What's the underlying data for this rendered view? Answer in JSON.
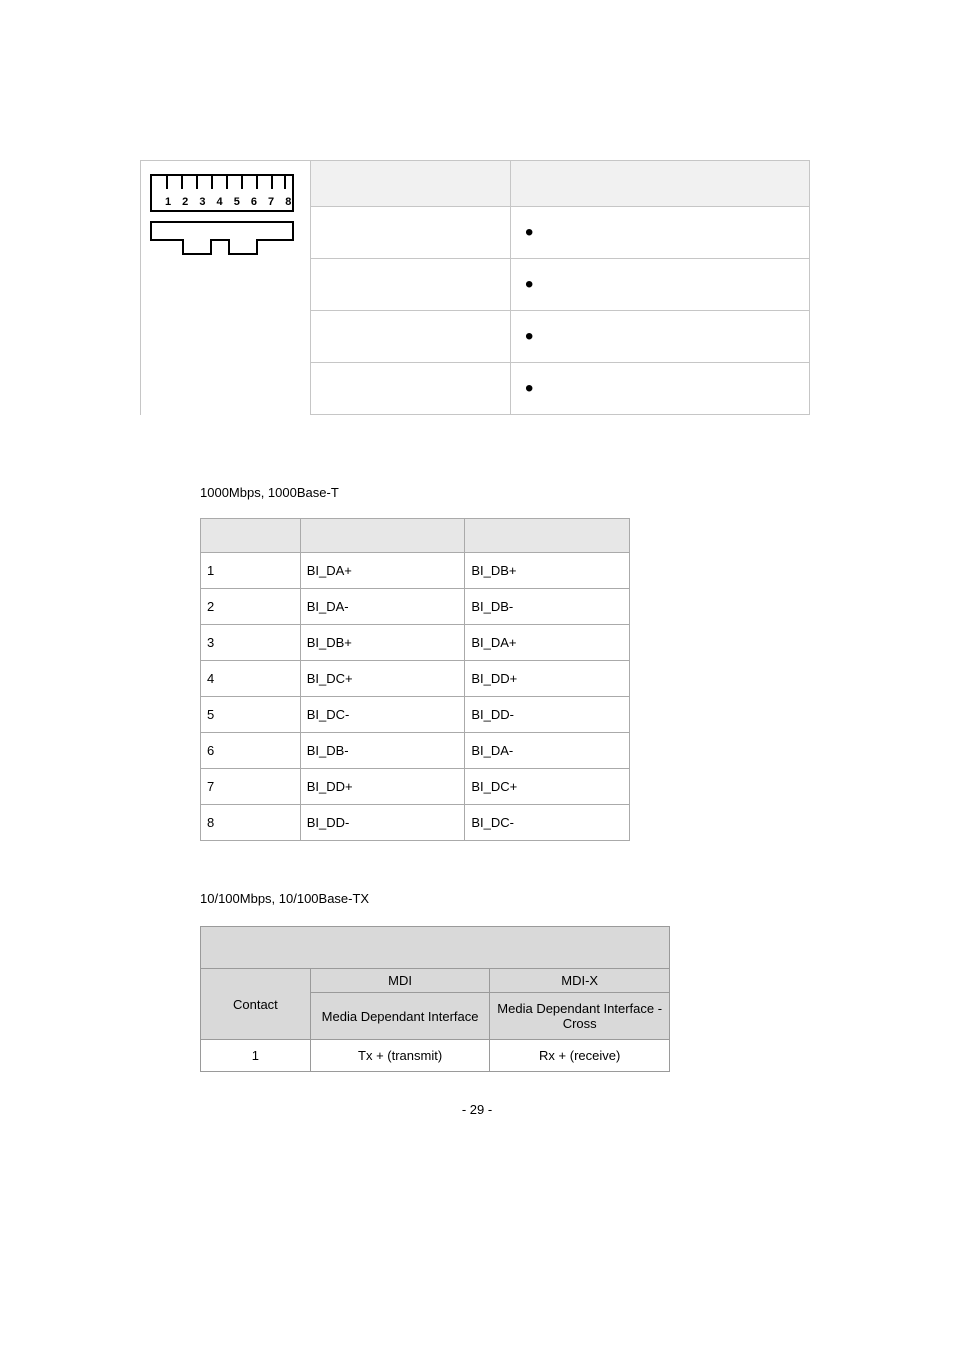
{
  "table1": {
    "connector_label": "1 2 3 4 5 6 7 8"
  },
  "section2": {
    "title": "1000Mbps, 1000Base-T",
    "rows": [
      {
        "c": "1",
        "mdi": "BI_DA+",
        "mdix": "BI_DB+"
      },
      {
        "c": "2",
        "mdi": "BI_DA-",
        "mdix": "BI_DB-"
      },
      {
        "c": "3",
        "mdi": "BI_DB+",
        "mdix": "BI_DA+"
      },
      {
        "c": "4",
        "mdi": "BI_DC+",
        "mdix": "BI_DD+"
      },
      {
        "c": "5",
        "mdi": "BI_DC-",
        "mdix": "BI_DD-"
      },
      {
        "c": "6",
        "mdi": "BI_DB-",
        "mdix": "BI_DA-"
      },
      {
        "c": "7",
        "mdi": "BI_DD+",
        "mdix": "BI_DC+"
      },
      {
        "c": "8",
        "mdi": "BI_DD-",
        "mdix": "BI_DC-"
      }
    ]
  },
  "section3": {
    "title": "10/100Mbps, 10/100Base-TX",
    "headers": {
      "contact": "Contact",
      "mdi": "MDI",
      "mdix": "MDI-X",
      "mdi_sub": "Media Dependant Interface",
      "mdix_sub": "Media Dependant Interface -Cross"
    },
    "rows": [
      {
        "c": "1",
        "mdi": "Tx + (transmit)",
        "mdix": "Rx + (receive)"
      }
    ]
  },
  "footer": "- 29 -"
}
